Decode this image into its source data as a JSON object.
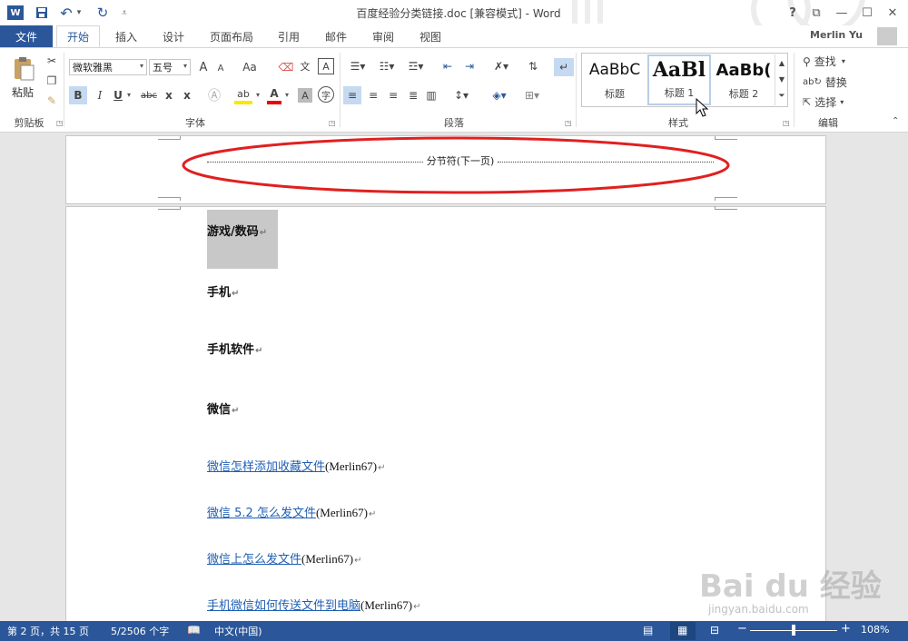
{
  "window": {
    "title": "百度经验分类链接.doc [兼容模式] - Word",
    "user": "Merlin Yu",
    "help": "?",
    "ribbon_display": "⧉",
    "minimize": "—",
    "maximize": "☐",
    "close": "✕"
  },
  "quick_access": {
    "app_icon": "W",
    "save": "💾",
    "undo": "↶",
    "undo_dropdown": "▾",
    "redo": "↻",
    "customize": "⩡"
  },
  "tabs": {
    "file": "文件",
    "items": [
      "开始",
      "插入",
      "设计",
      "页面布局",
      "引用",
      "邮件",
      "审阅",
      "视图"
    ]
  },
  "ribbon": {
    "clipboard": {
      "paste": "粘贴",
      "label": "剪贴板"
    },
    "font": {
      "name": "微软雅黑",
      "size": "五号",
      "grow": "A",
      "shrink": "A",
      "case": "Aa",
      "bold": "B",
      "italic": "I",
      "underline": "U",
      "strike": "abc",
      "subscript": "x",
      "superscript": "x",
      "font_color": "A",
      "char_shading": "A",
      "label": "字体"
    },
    "paragraph": {
      "label": "段落"
    },
    "styles": {
      "items": [
        {
          "sample": "AaBbC",
          "name": "标题"
        },
        {
          "sample": "AaBl",
          "name": "标题 1"
        },
        {
          "sample": "AaBb(",
          "name": "标题 2"
        }
      ],
      "label": "样式"
    },
    "editing": {
      "find": "查找",
      "replace": "替换",
      "select": "选择",
      "label": "编辑"
    }
  },
  "document": {
    "section_break": "分节符(下一页)",
    "lines": [
      {
        "text": "游戏/数码",
        "kind": "heading-highlighted"
      },
      {
        "text": "手机",
        "kind": "heading"
      },
      {
        "text": "手机软件",
        "kind": "heading"
      },
      {
        "text": "微信",
        "kind": "heading"
      },
      {
        "link": "微信怎样添加收藏文件",
        "suffix": "(Merlin67)"
      },
      {
        "link": "微信 5.2 怎么发文件",
        "suffix": "(Merlin67)"
      },
      {
        "link": "微信上怎么发文件",
        "suffix": "(Merlin67)"
      },
      {
        "link": "手机微信如何传送文件到电脑",
        "suffix": "(Merlin67)"
      }
    ],
    "para_mark": "↵"
  },
  "status": {
    "page": "第 2 页，共 15 页",
    "words": "5/2506 个字",
    "language": "中文(中国)",
    "zoom": "108%",
    "zoom_minus": "−",
    "zoom_plus": "+"
  },
  "watermark": {
    "brand": "Bai du 经验",
    "url": "jingyan.baidu.com"
  },
  "colors": {
    "accent": "#2b579a",
    "link": "#1f5fb3",
    "annotation": "#e02020",
    "highlight": "#c8c8c8"
  }
}
